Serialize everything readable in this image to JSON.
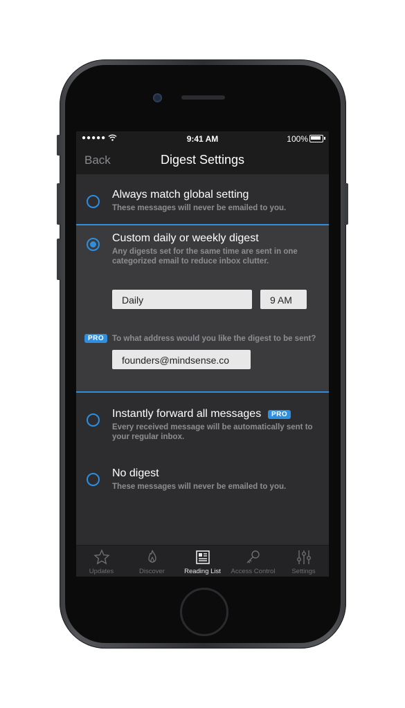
{
  "status": {
    "signal": "●●●●●",
    "time": "9:41 AM",
    "battery": "100%"
  },
  "nav": {
    "back": "Back",
    "title": "Digest Settings"
  },
  "options": {
    "always": {
      "title": "Always match global setting",
      "desc": "These messages will never be emailed to you."
    },
    "custom": {
      "title": "Custom daily or weekly digest",
      "desc": "Any digests set for the same time are sent in one categorized email to reduce inbox clutter.",
      "frequency": "Daily",
      "time": "9 AM",
      "pro_badge": "PRO",
      "address_prompt": "To what address would you like the digest to be sent?",
      "address": "founders@mindsense.co"
    },
    "forward": {
      "title": "Instantly forward all messages",
      "pro_badge": "PRO",
      "desc": "Every received message will be automatically sent to your regular inbox."
    },
    "none": {
      "title": "No digest",
      "desc": "These messages will never be emailed to you."
    }
  },
  "selected_option": "custom",
  "tabs": [
    {
      "label": "Updates",
      "icon": "star-icon"
    },
    {
      "label": "Discover",
      "icon": "flame-icon"
    },
    {
      "label": "Reading List",
      "icon": "newspaper-icon",
      "active": true
    },
    {
      "label": "Access Control",
      "icon": "key-icon"
    },
    {
      "label": "Settings",
      "icon": "sliders-icon"
    }
  ],
  "colors": {
    "accent": "#2f8fde",
    "background": "#2d2d2f",
    "bar": "#1c1c1d"
  }
}
